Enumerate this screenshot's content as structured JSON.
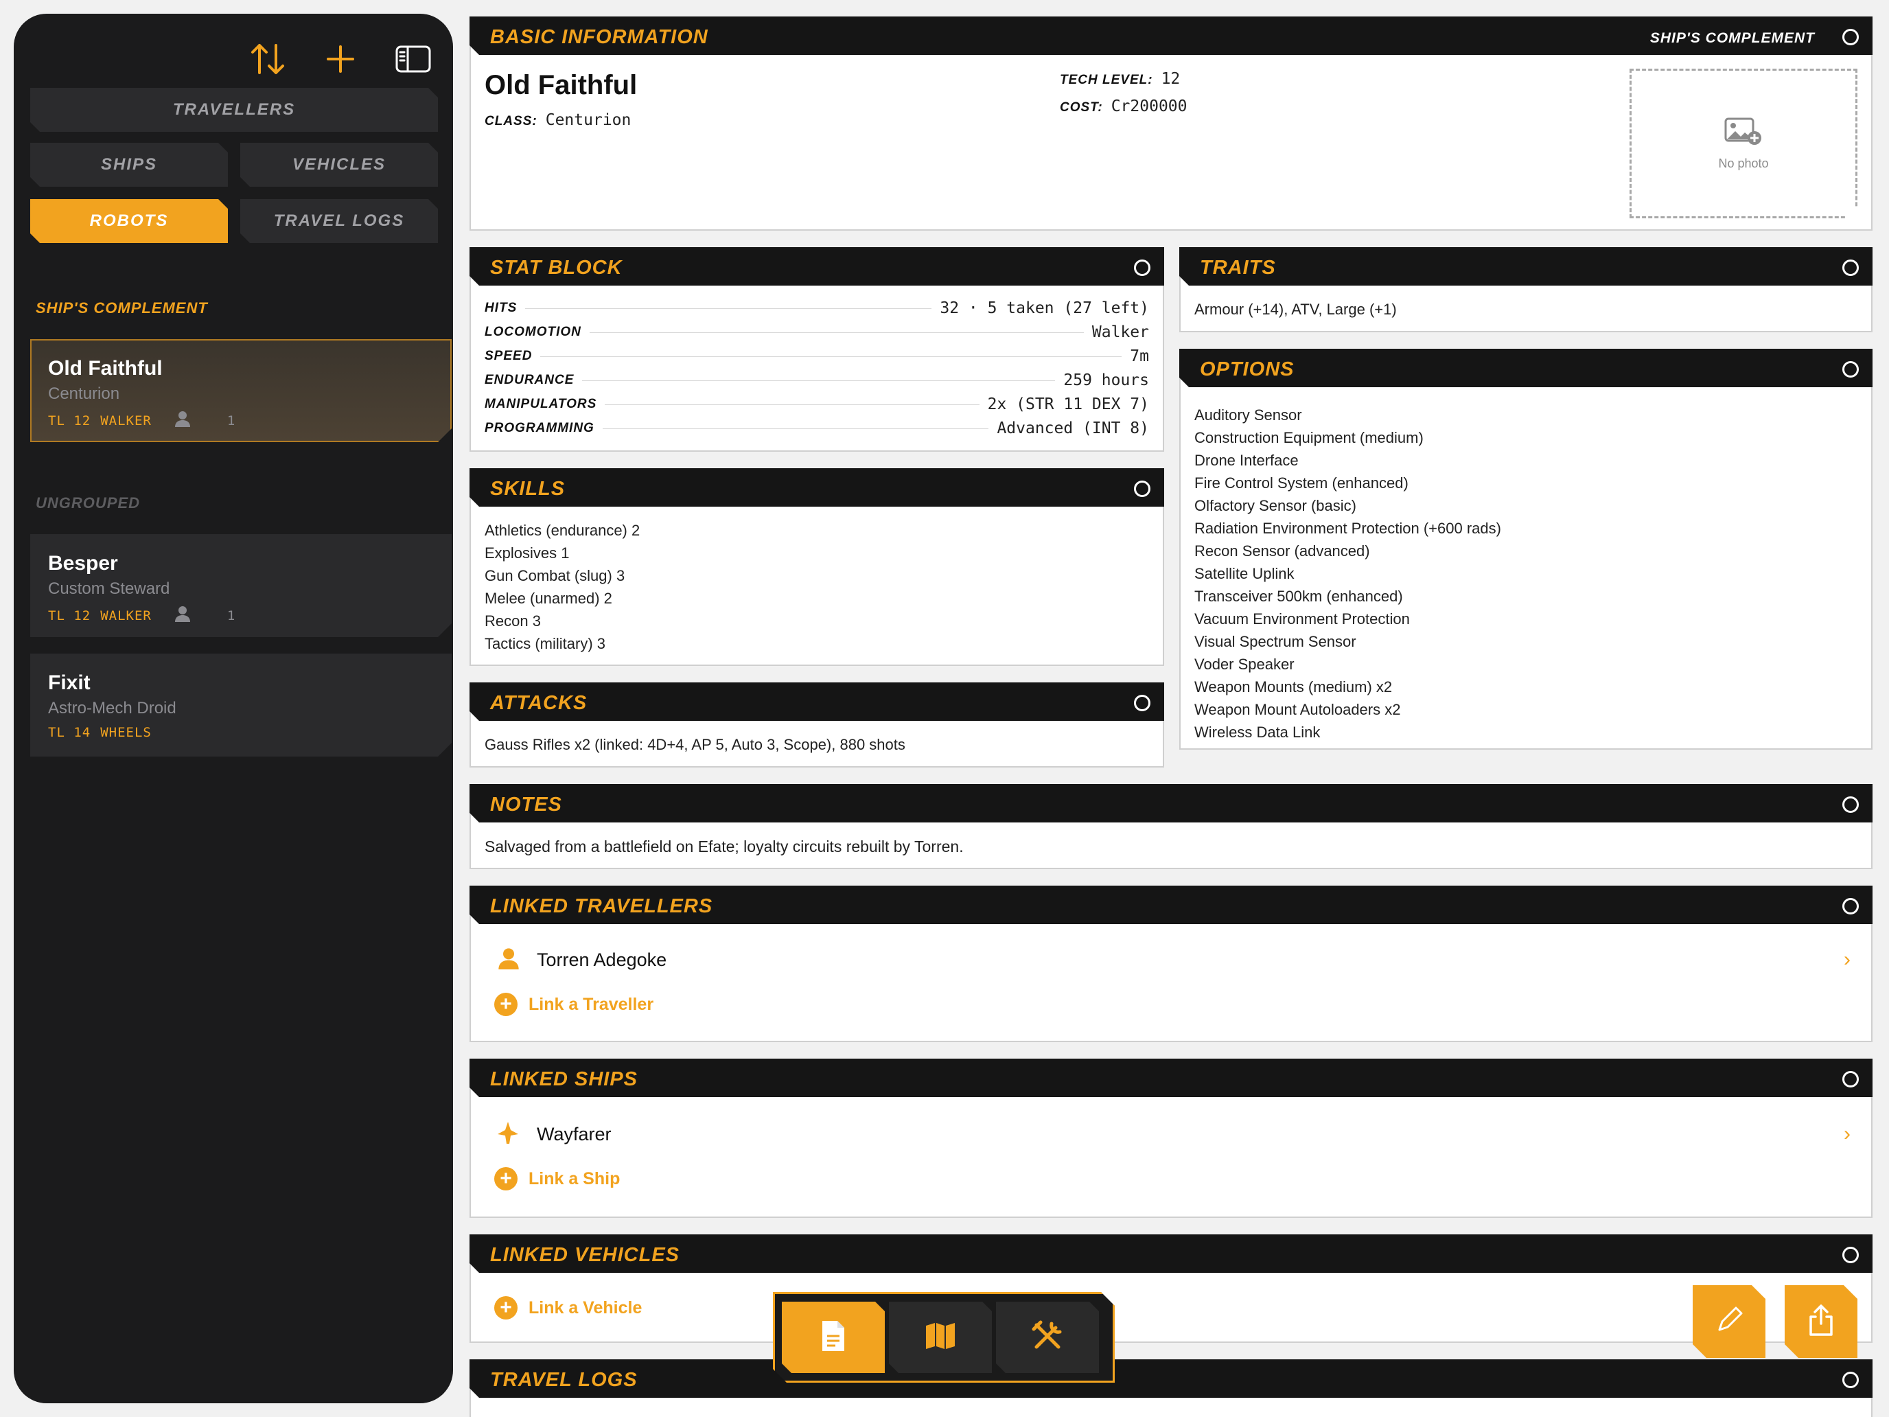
{
  "sidebar": {
    "tabs": {
      "travellers": "TRAVELLERS",
      "ships": "SHIPS",
      "vehicles": "VEHICLES",
      "robots": "ROBOTS",
      "travel_logs": "TRAVEL LOGS"
    },
    "groups": [
      {
        "title": "SHIP'S COMPLEMENT",
        "items": [
          {
            "name": "Old Faithful",
            "sub": "Centurion",
            "tl": "TL 12",
            "mode": "WALKER",
            "count": "1"
          }
        ]
      },
      {
        "title": "UNGROUPED",
        "items": [
          {
            "name": "Besper",
            "sub": "Custom Steward",
            "tl": "TL 12",
            "mode": "WALKER",
            "count": "1"
          },
          {
            "name": "Fixit",
            "sub": "Astro-Mech Droid",
            "tl": "TL 14",
            "mode": "WHEELS"
          }
        ]
      }
    ],
    "icons": [
      "sort-icon",
      "add-icon",
      "sidebar-toggle-icon",
      "person-icon"
    ]
  },
  "basic": {
    "title": "BASIC INFORMATION",
    "group": "SHIP'S COMPLEMENT",
    "name": "Old Faithful",
    "class_label": "CLASS:",
    "class_value": "Centurion",
    "tech_label": "TECH LEVEL:",
    "tech_value": "12",
    "cost_label": "COST:",
    "cost_value": "Cr200000",
    "photo_text": "No photo"
  },
  "stat_block": {
    "title": "STAT BLOCK",
    "rows": [
      {
        "label": "HITS",
        "value": "32 · 5 taken (27 left)"
      },
      {
        "label": "LOCOMOTION",
        "value": "Walker"
      },
      {
        "label": "SPEED",
        "value": "7m"
      },
      {
        "label": "ENDURANCE",
        "value": "259 hours"
      },
      {
        "label": "MANIPULATORS",
        "value": "2x (STR 11 DEX 7)"
      },
      {
        "label": "PROGRAMMING",
        "value": "Advanced (INT 8)"
      }
    ]
  },
  "traits": {
    "title": "TRAITS",
    "text": "Armour (+14), ATV, Large (+1)"
  },
  "skills": {
    "title": "SKILLS",
    "items": [
      "Athletics (endurance) 2",
      "Explosives 1",
      "Gun Combat (slug) 3",
      "Melee (unarmed) 2",
      "Recon 3",
      "Tactics (military) 3"
    ]
  },
  "options": {
    "title": "OPTIONS",
    "items": [
      "Auditory Sensor",
      "Construction Equipment (medium)",
      "Drone Interface",
      "Fire Control System (enhanced)",
      "Olfactory Sensor (basic)",
      "Radiation Environment Protection (+600 rads)",
      "Recon Sensor (advanced)",
      "Satellite Uplink",
      "Transceiver 500km (enhanced)",
      "Vacuum Environment Protection",
      "Visual Spectrum Sensor",
      "Voder Speaker",
      "Weapon Mounts (medium) x2",
      "Weapon Mount Autoloaders x2",
      "Wireless Data Link"
    ]
  },
  "attacks": {
    "title": "ATTACKS",
    "text": "Gauss Rifles x2 (linked: 4D+4, AP 5, Auto 3, Scope), 880 shots"
  },
  "notes": {
    "title": "NOTES",
    "text": "Salvaged from a battlefield on Efate; loyalty circuits rebuilt by Torren."
  },
  "linked_travellers": {
    "title": "LINKED TRAVELLERS",
    "items": [
      {
        "name": "Torren Adegoke"
      }
    ],
    "add": "Link a Traveller"
  },
  "linked_ships": {
    "title": "LINKED SHIPS",
    "items": [
      {
        "name": "Wayfarer"
      }
    ],
    "add": "Link a Ship"
  },
  "linked_vehicles": {
    "title": "LINKED VEHICLES",
    "add": "Link a Vehicle"
  },
  "travel_logs": {
    "title": "TRAVEL LOGS"
  },
  "colors": {
    "accent": "#f2a31f",
    "sidebar": "#1b1b1c",
    "header": "#151515"
  }
}
